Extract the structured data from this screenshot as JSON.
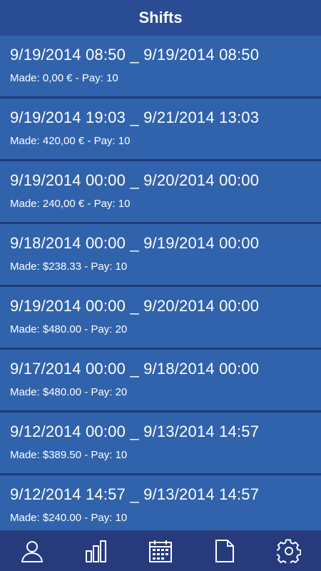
{
  "header": {
    "title": "Shifts"
  },
  "shifts": [
    {
      "range": "9/19/2014 08:50 _ 9/19/2014 08:50",
      "summary": "Made: 0,00 € - Pay: 10"
    },
    {
      "range": "9/19/2014 19:03 _ 9/21/2014 13:03",
      "summary": "Made: 420,00 € - Pay: 10"
    },
    {
      "range": "9/19/2014 00:00 _ 9/20/2014 00:00",
      "summary": "Made: 240,00 € - Pay: 10"
    },
    {
      "range": "9/18/2014 00:00 _ 9/19/2014 00:00",
      "summary": "Made: $238.33 - Pay: 10"
    },
    {
      "range": "9/19/2014 00:00 _ 9/20/2014 00:00",
      "summary": "Made: $480.00 - Pay: 20"
    },
    {
      "range": "9/17/2014 00:00 _ 9/18/2014 00:00",
      "summary": "Made: $480.00 - Pay: 20"
    },
    {
      "range": "9/12/2014 00:00 _ 9/13/2014 14:57",
      "summary": "Made: $389.50 - Pay: 10"
    },
    {
      "range": "9/12/2014 14:57 _ 9/13/2014 14:57",
      "summary": "Made: $240.00 - Pay: 10"
    }
  ],
  "navbar": {
    "items": [
      {
        "icon": "person-icon"
      },
      {
        "icon": "bar-chart-icon"
      },
      {
        "icon": "calendar-icon"
      },
      {
        "icon": "document-icon"
      },
      {
        "icon": "gear-icon"
      }
    ]
  },
  "colors": {
    "header_bg": "#2a4c94",
    "row_bg": "#3163ac",
    "row_divider": "#1d3b7a",
    "navbar_bg": "#263a7c",
    "text": "#ffffff"
  }
}
